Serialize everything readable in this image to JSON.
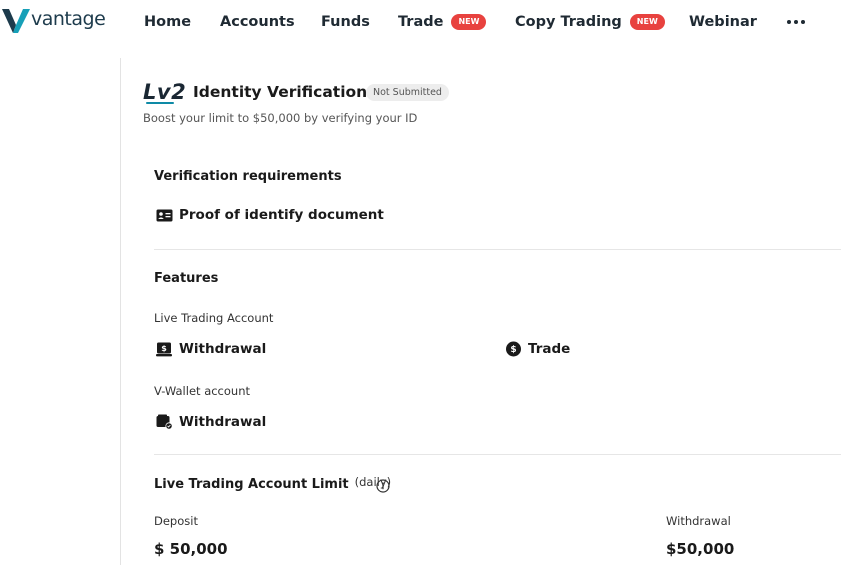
{
  "brand": {
    "name": "vantage",
    "colors": {
      "mark_dark": "#1d3b4c",
      "mark_accent": "#17a0b8"
    }
  },
  "nav": {
    "items": [
      {
        "label": "Home"
      },
      {
        "label": "Accounts"
      },
      {
        "label": "Funds"
      },
      {
        "label": "Trade",
        "badge": "NEW"
      },
      {
        "label": "Copy Trading",
        "badge": "NEW"
      },
      {
        "label": "Webinar"
      }
    ],
    "more_icon": "more-horizontal-icon",
    "badge_color": "#e8423f"
  },
  "header": {
    "level": "Lv2",
    "title": "Identity Verification",
    "status": "Not Submitted",
    "subtitle": "Boost your limit to $50,000 by verifying your ID"
  },
  "requirements": {
    "title": "Verification requirements",
    "items": [
      {
        "icon": "id-card-icon",
        "label": "Proof of identify document"
      }
    ]
  },
  "features": {
    "title": "Features",
    "groups": [
      {
        "label": "Live Trading Account",
        "items": [
          {
            "icon": "wallet-dollar-icon",
            "label": "Withdrawal"
          },
          {
            "icon": "dollar-circle-icon",
            "label": "Trade"
          }
        ]
      },
      {
        "label": "V-Wallet account",
        "items": [
          {
            "icon": "wallet-check-icon",
            "label": "Withdrawal"
          }
        ]
      }
    ]
  },
  "limit": {
    "title": "Live Trading Account Limit",
    "period": "(daily)",
    "info_icon": "info-icon",
    "deposit_label": "Deposit",
    "deposit_value": "$ 50,000",
    "withdrawal_label": "Withdrawal",
    "withdrawal_value": "$50,000"
  }
}
